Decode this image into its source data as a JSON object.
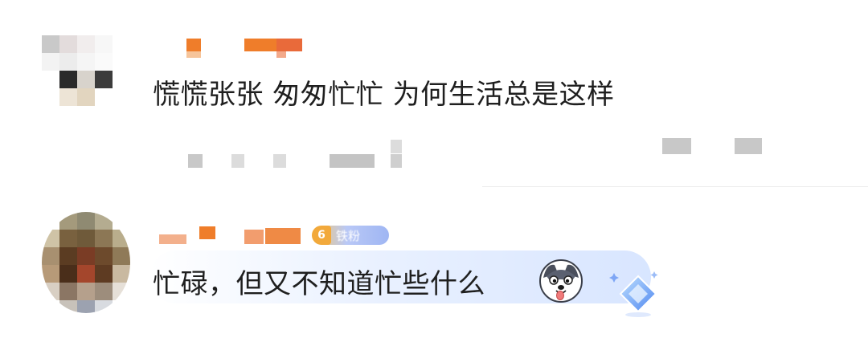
{
  "comments": [
    {
      "text": "慌慌张张 匆匆忙忙 为何生活总是这样",
      "avatar_icon": "pixelated-avatar",
      "username_colors": [
        "#ef7d2a",
        "#ef7d2a",
        "#e96a3a"
      ]
    },
    {
      "text": "忙碌，但又不知道忙些什么",
      "avatar_icon": "pixelated-avatar",
      "level_badge": {
        "number": "6",
        "label": "铁粉"
      },
      "reaction_icon": "husky-emoji-icon",
      "decoration_icon": "diamond-gem-icon"
    }
  ],
  "colors": {
    "text": "#1f1f1f",
    "username": "#ef7d2a",
    "divider": "#ececec",
    "level_badge": "#f2a93b",
    "bubble": "#d6e4ff"
  }
}
